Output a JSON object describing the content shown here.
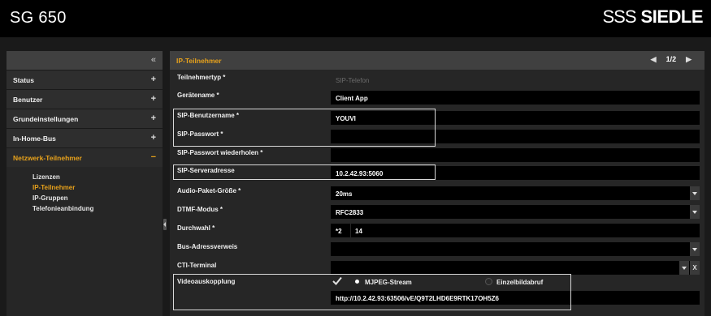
{
  "header": {
    "product": "SG 650",
    "brand_mark": "SSS",
    "brand_name": "SIEDLE"
  },
  "sidebar": {
    "collapse_icon": "«",
    "items": [
      {
        "label": "Status",
        "sign": "+"
      },
      {
        "label": "Benutzer",
        "sign": "+"
      },
      {
        "label": "Grundeinstellungen",
        "sign": "+"
      },
      {
        "label": "In-Home-Bus",
        "sign": "+"
      },
      {
        "label": "Netzwerk-Teilnehmer",
        "sign": "−"
      }
    ],
    "subitems": [
      "Lizenzen",
      "IP-Teilnehmer",
      "IP-Gruppen",
      "Telefonieanbindung"
    ]
  },
  "main": {
    "title": "IP-Teilnehmer",
    "pager": {
      "prev": "◀",
      "page": "1/2",
      "next": "▶"
    },
    "fields": [
      {
        "label": "Teilnehmertyp *",
        "value": "SIP-Telefon"
      },
      {
        "label": "Gerätename *",
        "value": "Client App"
      },
      {
        "label": "SIP-Benutzername *",
        "value": "YOUVI"
      },
      {
        "label": "SIP-Passwort *",
        "value": ""
      },
      {
        "label": "SIP-Passwort wiederholen *",
        "value": ""
      },
      {
        "label": "SIP-Serveradresse",
        "value": "10.2.42.93:5060"
      },
      {
        "label": "Audio-Paket-Größe *",
        "value": "20ms"
      },
      {
        "label": "DTMF-Modus *",
        "value": "RFC2833"
      },
      {
        "label": "Durchwahl *",
        "prefix": "*2",
        "value": "14"
      },
      {
        "label": "Bus-Adressverweis",
        "value": ""
      },
      {
        "label": "CTI-Terminal",
        "value": "",
        "clear": "X"
      }
    ],
    "video": {
      "label": "Videoauskopplung",
      "option1": "MJPEG-Stream",
      "option2": "Einzelbildabruf",
      "url": "http://10.2.42.93:63506/vE/Q9T2LHD6E9RTK17OH5Z6"
    }
  },
  "colors": {
    "accent": "#e8a21b",
    "background": "#1a1a1a",
    "panel": "#262626",
    "header": "#404040",
    "field": "#000000"
  },
  "icons": [
    "chevrons-left-icon",
    "plus-icon",
    "minus-icon",
    "triangle-left-icon",
    "triangle-right-icon",
    "dropdown-arrow-icon",
    "clear-x-icon",
    "checkmark-icon",
    "radio-icon"
  ]
}
